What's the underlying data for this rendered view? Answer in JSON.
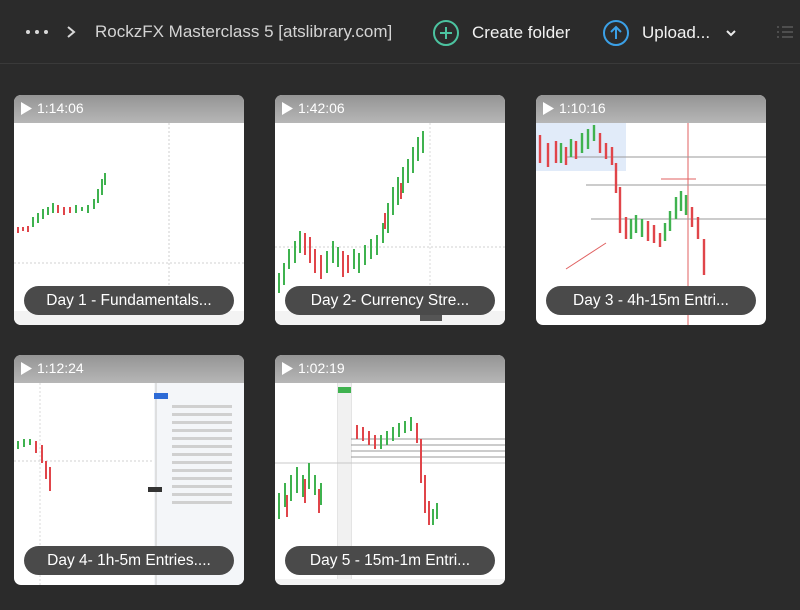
{
  "header": {
    "breadcrumb_title": "RockzFX Masterclass 5 [atslibrary.com]",
    "create_folder_label": "Create folder",
    "upload_label": "Upload..."
  },
  "colors": {
    "background": "#2b2b2b",
    "accent_create": "#4cc3a0",
    "accent_upload": "#3ba0e6",
    "candle_up": "#3fb24f",
    "candle_down": "#e0454a"
  },
  "files": [
    {
      "duration": "1:14:06",
      "title": "Day 1 - Fundamentals..."
    },
    {
      "duration": "1:42:06",
      "title": "Day 2- Currency Stre..."
    },
    {
      "duration": "1:10:16",
      "title": "Day 3 - 4h-15m Entri..."
    },
    {
      "duration": "1:12:24",
      "title": "Day 4- 1h-5m Entries...."
    },
    {
      "duration": "1:02:19",
      "title": "Day 5 - 15m-1m Entri..."
    }
  ]
}
